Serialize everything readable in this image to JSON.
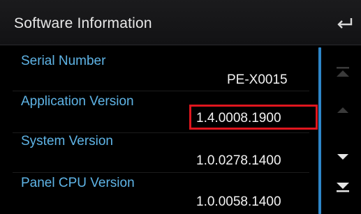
{
  "header": {
    "title": "Software Information",
    "back_icon": "back-arrow-icon"
  },
  "items": [
    {
      "label": "Serial Number",
      "value": "PE-X0015"
    },
    {
      "label": "Application Version",
      "value": "1.4.0008.1900"
    },
    {
      "label": "System Version",
      "value": "1.0.0278.1400"
    },
    {
      "label": "Panel CPU Version",
      "value": "1.0.0058.1400"
    }
  ],
  "scroll_controls": {
    "top_icon": "scroll-to-top-icon",
    "up_icon": "scroll-up-icon",
    "down_icon": "scroll-down-icon",
    "bottom_icon": "scroll-to-bottom-icon"
  },
  "colors": {
    "label": "#5fb4e6",
    "value": "#f2f2f2",
    "highlight_box": "#e0161e",
    "scrollbar": "#2e86c8"
  }
}
